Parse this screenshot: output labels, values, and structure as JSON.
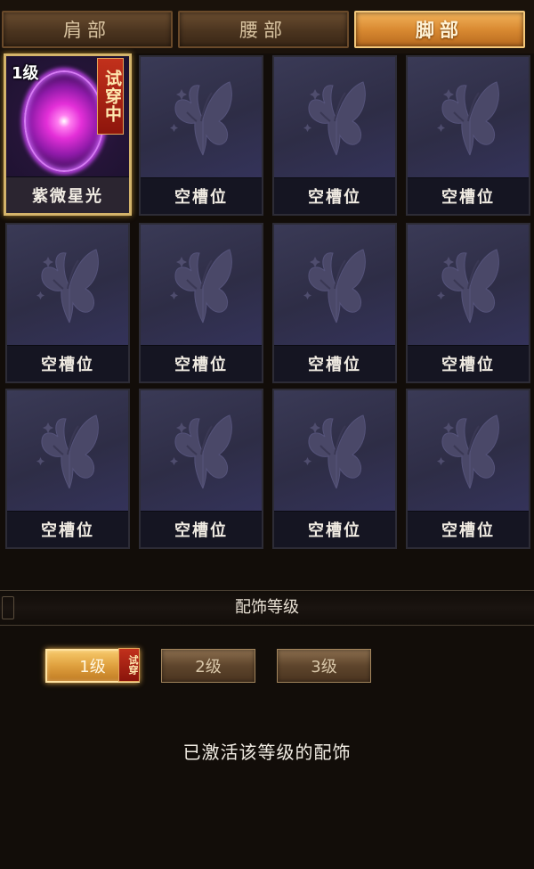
{
  "tabs": [
    {
      "label": "肩部",
      "active": false
    },
    {
      "label": "腰部",
      "active": false
    },
    {
      "label": "脚部",
      "active": true
    }
  ],
  "slots": [
    {
      "label": "紫微星光",
      "level": "1级",
      "badge": "试穿中",
      "equipped": true
    },
    {
      "label": "空槽位"
    },
    {
      "label": "空槽位"
    },
    {
      "label": "空槽位"
    },
    {
      "label": "空槽位"
    },
    {
      "label": "空槽位"
    },
    {
      "label": "空槽位"
    },
    {
      "label": "空槽位"
    },
    {
      "label": "空槽位"
    },
    {
      "label": "空槽位"
    },
    {
      "label": "空槽位"
    },
    {
      "label": "空槽位"
    }
  ],
  "level_section": {
    "title": "配饰等级",
    "levels": [
      {
        "label": "1级",
        "badge": "试穿",
        "active": true
      },
      {
        "label": "2级",
        "active": false
      },
      {
        "label": "3级",
        "active": false
      }
    ],
    "status": "已激活该等级的配饰"
  },
  "colors": {
    "accent": "#e3a040",
    "background": "#120d09",
    "slot_bg": "#2a2a3e",
    "badge_red": "#b02a18"
  },
  "icons": {
    "empty_slot": "butterfly-icon",
    "equipped_item": "purple-orb-icon"
  }
}
